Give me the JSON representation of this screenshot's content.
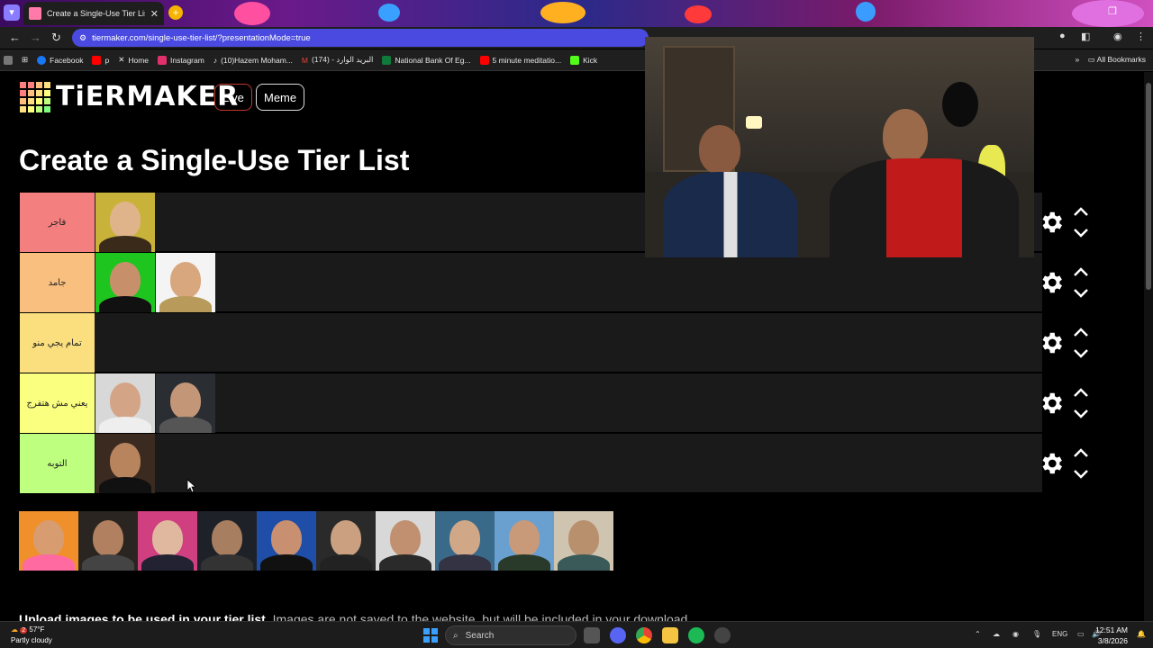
{
  "browser": {
    "tab_title": "Create a Single-Use Tier List (P",
    "tab_close": "✕",
    "new_tab": "+",
    "url": "tiermaker.com/single-use-tier-list/?presentationMode=true",
    "bookmarks": [
      {
        "label": "Facebook",
        "color": "#1877f2"
      },
      {
        "label": "p",
        "color": "#ff0000"
      },
      {
        "label": "Home",
        "color": "#ffffff"
      },
      {
        "label": "Instagram",
        "color": "#e1306c"
      },
      {
        "label": "(10)Hazem Moham...",
        "color": "#ffffff"
      },
      {
        "label": "(174) - البريد الوارد",
        "color": "#ea4335"
      },
      {
        "label": "National Bank Of Eg...",
        "color": "#0f7a3a"
      },
      {
        "label": "5 minute meditatio...",
        "color": "#ff0000"
      },
      {
        "label": "Kick",
        "color": "#53fc18"
      }
    ],
    "all_bookmarks": "All Bookmarks",
    "bookmarks_more": "»"
  },
  "site": {
    "logo_text": "TiERMAKER",
    "live_label": "Live",
    "meme_label": "Meme",
    "heading": "Create a Single-Use Tier List",
    "upload_bold": "Upload images to be used in your tier list.",
    "upload_rest": " Images are not saved to the website, but will be included in your download."
  },
  "tiers": [
    {
      "label": "فاجر",
      "color": "#f47f7f",
      "items": 1
    },
    {
      "label": "جامد",
      "color": "#f9bf7f",
      "items": 2
    },
    {
      "label": "تمام يجي منو",
      "color": "#fbdf7f",
      "items": 0
    },
    {
      "label": "يعني مش هتفرج",
      "color": "#fbff7f",
      "items": 2
    },
    {
      "label": "التوبه",
      "color": "#bfff7f",
      "items": 1
    }
  ],
  "pool_count": 10,
  "taskbar": {
    "weather_temp": "57°F",
    "weather_desc": "Partly cloudy",
    "weather_badge": "2",
    "search_placeholder": "Search",
    "lang": "ENG",
    "time": "12:51 AM",
    "date": "3/8/2026"
  }
}
